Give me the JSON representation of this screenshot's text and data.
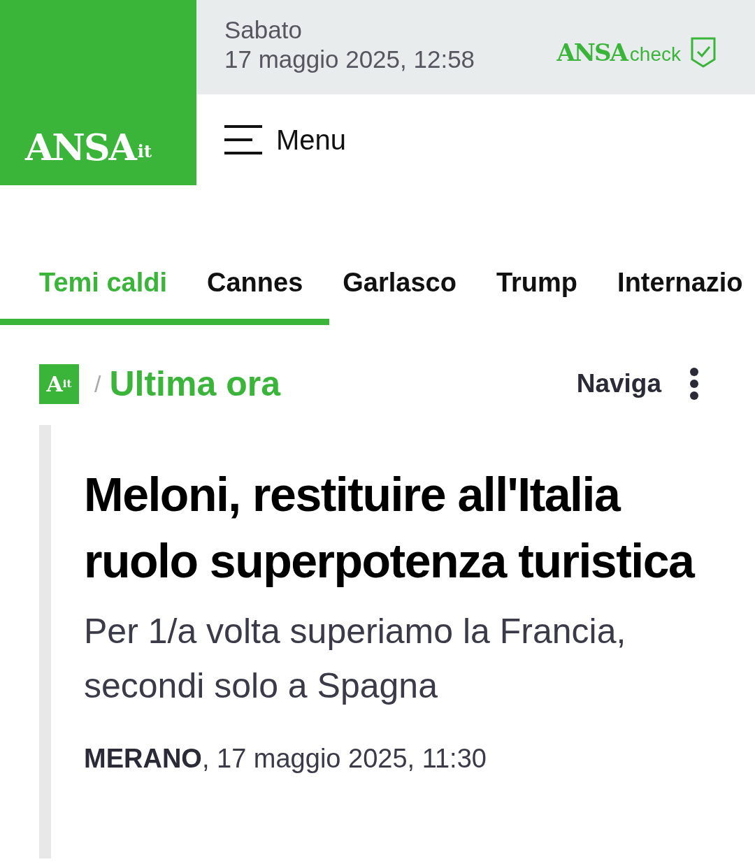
{
  "header": {
    "logo": {
      "main": "ANSA",
      "suffix": "it"
    },
    "day": "Sabato",
    "datetime": "17 maggio 2025, 12:58",
    "check_logo": {
      "main": "ANSA",
      "suffix": "check"
    },
    "menu_label": "Menu"
  },
  "tabs": [
    {
      "label": "Temi caldi",
      "selected": true
    },
    {
      "label": "Cannes",
      "selected": false
    },
    {
      "label": "Garlasco",
      "selected": false
    },
    {
      "label": "Trump",
      "selected": false
    },
    {
      "label": "Internazio",
      "selected": false
    }
  ],
  "breadcrumb": {
    "logo": {
      "main": "A",
      "suffix": "it"
    },
    "separator": "/",
    "section": "Ultima ora",
    "navigate": "Naviga"
  },
  "article": {
    "title": "Meloni, restituire all'Italia ruolo superpotenza turistica",
    "subtitle": "Per 1/a volta superiamo la Francia, secondi solo a Spagna",
    "place": "MERANO",
    "date": ", 17 maggio 2025, 11:30"
  }
}
